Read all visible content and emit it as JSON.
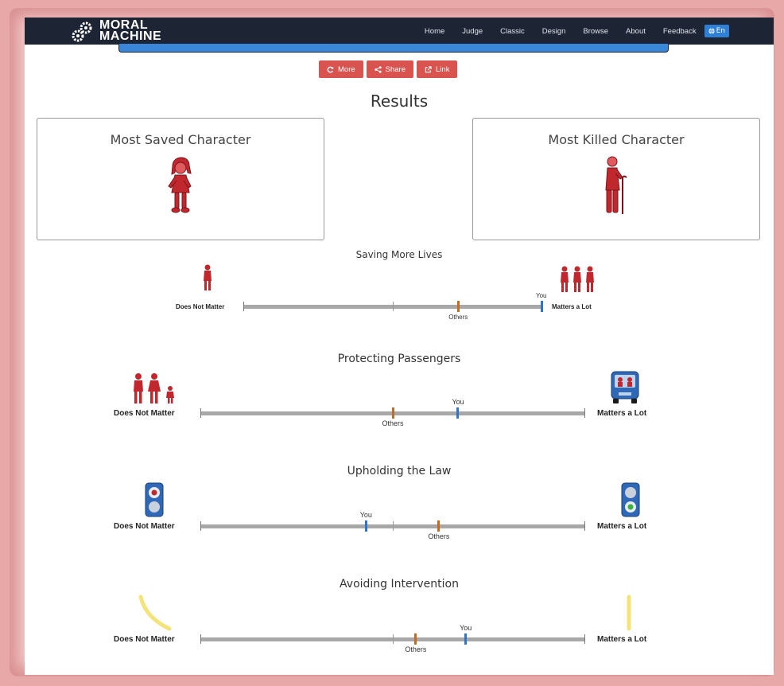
{
  "navbar": {
    "logo_line1": "MORAL",
    "logo_line2": "MACHINE",
    "links": [
      "Home",
      "Judge",
      "Classic",
      "Design",
      "Browse",
      "About",
      "Feedback"
    ],
    "lang": "En"
  },
  "actions": {
    "more": "More",
    "share": "Share",
    "link": "Link"
  },
  "results_title": "Results",
  "most_saved": {
    "title": "Most Saved Character",
    "icon": "girl-icon"
  },
  "most_killed": {
    "title": "Most Killed Character",
    "icon": "elderly-man-icon"
  },
  "scales": [
    {
      "title": "Saving More Lives",
      "left_label": "Does Not Matter",
      "right_label": "Matters a Lot",
      "you": 1.0,
      "others": 0.72,
      "you_label": "You",
      "others_label": "Others"
    },
    {
      "title": "Protecting Passengers",
      "left_label": "Does Not Matter",
      "right_label": "Matters a Lot",
      "you": 0.67,
      "others": 0.5,
      "you_label": "You",
      "others_label": "Others"
    },
    {
      "title": "Upholding the Law",
      "left_label": "Does Not Matter",
      "right_label": "Matters a Lot",
      "you": 0.43,
      "others": 0.62,
      "you_label": "You",
      "others_label": "Others"
    },
    {
      "title": "Avoiding Intervention",
      "left_label": "Does Not Matter",
      "right_label": "Matters a Lot",
      "you": 0.69,
      "others": 0.56,
      "you_label": "You",
      "others_label": "Others"
    }
  ],
  "colors": {
    "accent_red": "#d9534f",
    "navbar": "#1d2434",
    "you": "#3076c8",
    "others": "#c46a22",
    "figure_red": "#c0282e"
  }
}
